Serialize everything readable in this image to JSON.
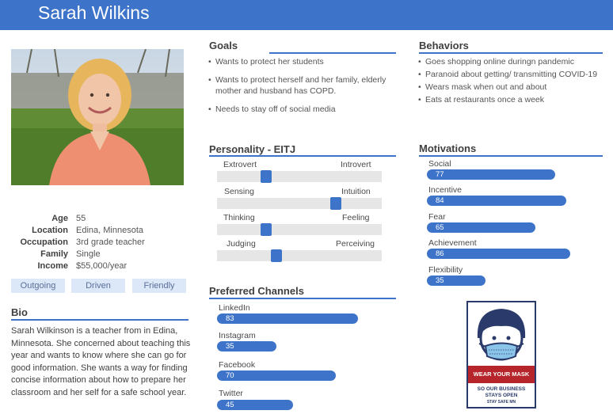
{
  "persona": {
    "name": "Sarah Wilkins"
  },
  "info": [
    {
      "label": "Age",
      "value": "55"
    },
    {
      "label": "Location",
      "value": "Edina, Minnesota"
    },
    {
      "label": "Occupation",
      "value": "3rd grade teacher"
    },
    {
      "label": "Family",
      "value": "Single"
    },
    {
      "label": "Income",
      "value": "$55,000/year"
    }
  ],
  "traits": [
    "Outgoing",
    "Driven",
    "Friendly"
  ],
  "bio": {
    "title": "Bio",
    "text": "Sarah Wilkinson is a teacher from in Edina, Minnesota. She concerned about teaching this year and wants to know where she can go for good information. She wants a way for finding concise information about how to prepare her classroom and her self for a safe school year."
  },
  "goals": {
    "title": "Goals",
    "items": [
      "Wants to protect her students",
      "Wants to protect herself and her family, elderly mother and husband has COPD.",
      "Needs to stay off of social media"
    ]
  },
  "behaviors": {
    "title": "Behaviors",
    "items": [
      "Goes shopping online duringn pandemic",
      "Paranoid about getting/ transmitting COVID-19",
      "Wears mask when out and about",
      "Eats at restaurants once a week"
    ]
  },
  "personality": {
    "title": "Personality - EITJ",
    "scales": [
      {
        "left": "Extrovert",
        "right": "Introvert",
        "position": 0.3
      },
      {
        "left": "Sensing",
        "right": "Intuition",
        "position": 0.72
      },
      {
        "left": "Thinking",
        "right": "Feeling",
        "position": 0.3
      },
      {
        "left": "Judging",
        "right": "Perceiving",
        "position": 0.36
      }
    ]
  },
  "motivations": {
    "title": "Motivations",
    "items": [
      {
        "label": "Social",
        "value": 77
      },
      {
        "label": "Incentive",
        "value": 84
      },
      {
        "label": "Fear",
        "value": 65
      },
      {
        "label": "Achievement",
        "value": 86
      },
      {
        "label": "Flexibility",
        "value": 35
      }
    ]
  },
  "channels": {
    "title": "Preferred Channels",
    "items": [
      {
        "label": "LinkedIn",
        "value": 83
      },
      {
        "label": "Instagram",
        "value": 35
      },
      {
        "label": "Facebook",
        "value": 70
      },
      {
        "label": "Twitter",
        "value": 45
      }
    ]
  },
  "poster": {
    "banner": "WEAR YOUR MASK",
    "subtitle_1": "SO OUR BUSINESS",
    "subtitle_2": "STAYS OPEN",
    "logo": "STAY SAFE MN"
  },
  "colors": {
    "accent": "#3d74c9",
    "track": "#e6e6e6",
    "trait_bg": "#dce8f7"
  }
}
